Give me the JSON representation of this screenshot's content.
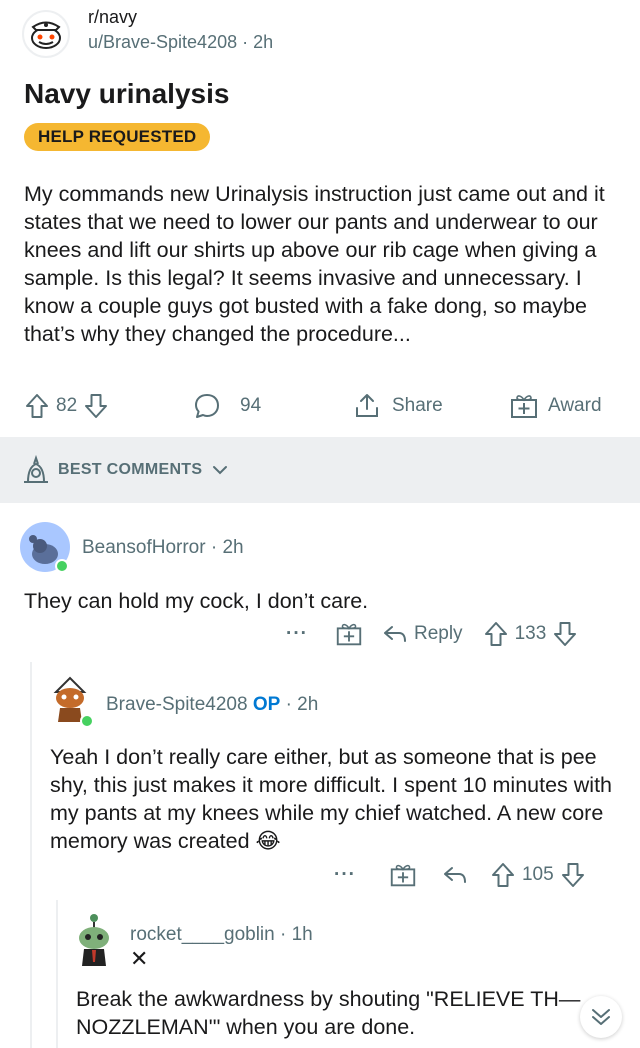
{
  "header": {
    "subreddit": "r/navy",
    "username": "u/Brave-Spite4208",
    "time": "2h"
  },
  "post": {
    "title": "Navy urinalysis",
    "flair": "HELP REQUESTED",
    "body": "My commands new Urinalysis instruction just came out and it states that we need to lower our pants and underwear to our knees and lift our shirts up above our rib cage when giving a sample. Is this legal? It seems invasive and unnecessary. I know a couple guys got busted with a fake dong, so maybe that’s why they changed the procedure...",
    "votes": "82",
    "comments": "94",
    "share_label": "Share",
    "award_label": "Award"
  },
  "sort": {
    "label": "BEST COMMENTS"
  },
  "comments": [
    {
      "author": "BeansofHorror",
      "time": "2h",
      "text": "They can hold my cock, I don’t care.",
      "more": "···",
      "reply_label": "Reply",
      "votes": "133"
    },
    {
      "author": "Brave-Spite4208",
      "op_tag": "OP",
      "time": "2h",
      "text": "Yeah I don’t really care either, but as someone that is pee shy, this just makes it more difficult. I spent 10 minutes with my pants at my knees while my chief watched. A new core memory was created",
      "emoji": "😂",
      "more": "···",
      "votes": "105"
    },
    {
      "author": "rocket____goblin",
      "time": "1h",
      "badge": "✕",
      "text": "Break the awkwardness by shouting \"RELIEVE TH— NOZZLEMAN'\" when you are done."
    }
  ],
  "colors": {
    "flair": "#f5b731",
    "meta": "#576f76",
    "op": "#0079d3",
    "online": "#46d160",
    "band": "#edeff1"
  },
  "icons": [
    "snoo-avatar-icon",
    "upvote-icon",
    "downvote-icon",
    "comment-icon",
    "share-icon",
    "award-icon",
    "lamp-icon",
    "chevron-down-icon",
    "reply-icon",
    "more-icon",
    "collapse-chevron-icon"
  ]
}
